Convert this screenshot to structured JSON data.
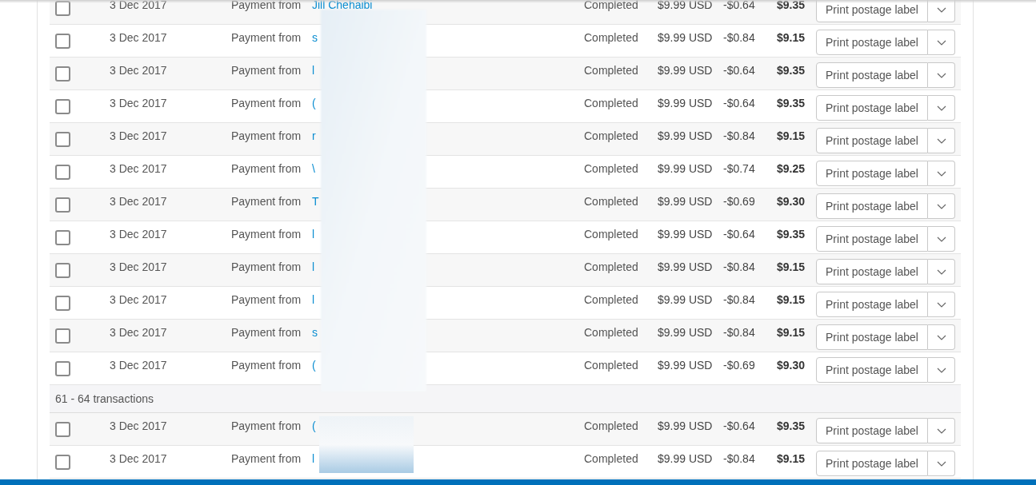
{
  "groups": [
    {
      "rows": [
        {
          "checked": false,
          "date": "3 Dec 2017",
          "type": "Payment from",
          "name": "Jill Chehaibi",
          "status": "Completed",
          "gross": "$9.99 USD",
          "fee": "-$0.64",
          "net": "$9.35",
          "action": "Print postage label"
        },
        {
          "checked": false,
          "date": "3 Dec 2017",
          "type": "Payment from",
          "name": "s",
          "status": "Completed",
          "gross": "$9.99 USD",
          "fee": "-$0.84",
          "net": "$9.15",
          "action": "Print postage label"
        },
        {
          "checked": false,
          "date": "3 Dec 2017",
          "type": "Payment from",
          "name": "l",
          "status": "Completed",
          "gross": "$9.99 USD",
          "fee": "-$0.64",
          "net": "$9.35",
          "action": "Print postage label"
        },
        {
          "checked": false,
          "date": "3 Dec 2017",
          "type": "Payment from",
          "name": "(",
          "status": "Completed",
          "gross": "$9.99 USD",
          "fee": "-$0.64",
          "net": "$9.35",
          "action": "Print postage label"
        },
        {
          "checked": false,
          "date": "3 Dec 2017",
          "type": "Payment from",
          "name": "r",
          "status": "Completed",
          "gross": "$9.99 USD",
          "fee": "-$0.84",
          "net": "$9.15",
          "action": "Print postage label"
        },
        {
          "checked": false,
          "date": "3 Dec 2017",
          "type": "Payment from",
          "name": "\\",
          "status": "Completed",
          "gross": "$9.99 USD",
          "fee": "-$0.74",
          "net": "$9.25",
          "action": "Print postage label"
        },
        {
          "checked": false,
          "date": "3 Dec 2017",
          "type": "Payment from",
          "name": "T",
          "status": "Completed",
          "gross": "$9.99 USD",
          "fee": "-$0.69",
          "net": "$9.30",
          "action": "Print postage label"
        },
        {
          "checked": false,
          "date": "3 Dec 2017",
          "type": "Payment from",
          "name": "l",
          "status": "Completed",
          "gross": "$9.99 USD",
          "fee": "-$0.64",
          "net": "$9.35",
          "action": "Print postage label"
        },
        {
          "checked": false,
          "date": "3 Dec 2017",
          "type": "Payment from",
          "name": "l",
          "status": "Completed",
          "gross": "$9.99 USD",
          "fee": "-$0.84",
          "net": "$9.15",
          "action": "Print postage label"
        },
        {
          "checked": false,
          "date": "3 Dec 2017",
          "type": "Payment from",
          "name": "l",
          "status": "Completed",
          "gross": "$9.99 USD",
          "fee": "-$0.84",
          "net": "$9.15",
          "action": "Print postage label"
        },
        {
          "checked": false,
          "date": "3 Dec 2017",
          "type": "Payment from",
          "name": "s",
          "status": "Completed",
          "gross": "$9.99 USD",
          "fee": "-$0.84",
          "net": "$9.15",
          "action": "Print postage label"
        },
        {
          "checked": false,
          "date": "3 Dec 2017",
          "type": "Payment from",
          "name": "(",
          "status": "Completed",
          "gross": "$9.99 USD",
          "fee": "-$0.69",
          "net": "$9.30",
          "action": "Print postage label"
        }
      ]
    },
    {
      "header": "61 - 64 transactions",
      "rows": [
        {
          "checked": false,
          "date": "3 Dec 2017",
          "type": "Payment from",
          "name": "(",
          "status": "Completed",
          "gross": "$9.99 USD",
          "fee": "-$0.64",
          "net": "$9.35",
          "action": "Print postage label"
        },
        {
          "checked": false,
          "date": "3 Dec 2017",
          "type": "Payment from",
          "name": "l",
          "status": "Completed",
          "gross": "$9.99 USD",
          "fee": "-$0.84",
          "net": "$9.15",
          "action": "Print postage label"
        }
      ]
    }
  ]
}
